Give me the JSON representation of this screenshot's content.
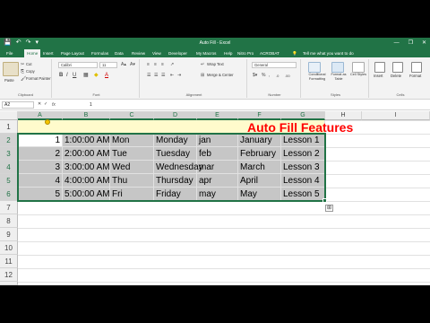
{
  "window": {
    "title": "Auto Fill - Excel",
    "qat": [
      "💾",
      "↶",
      "↷",
      "▾"
    ],
    "controls": [
      "—",
      "❐",
      "✕"
    ]
  },
  "tabs": [
    "File",
    "Home",
    "Insert",
    "Page Layout",
    "Formulas",
    "Data",
    "Review",
    "View",
    "Developer",
    "My Macros",
    "Help",
    "Nitro Pro",
    "ACROBAT"
  ],
  "active_tab": "Home",
  "tell_me": "Tell me what you want to do",
  "ribbon": {
    "clipboard": {
      "paste": "Paste",
      "cut": "Cut",
      "copy": "Copy",
      "format_painter": "Format Painter",
      "label": "Clipboard"
    },
    "font": {
      "name": "Calibri",
      "size": "11",
      "label": "Font"
    },
    "alignment": {
      "wrap": "Wrap Text",
      "merge": "Merge & Center",
      "label": "Alignment"
    },
    "number": {
      "format": "General",
      "label": "Number"
    },
    "styles": {
      "conditional": "Conditional Formatting",
      "format_table": "Format as Table",
      "cell_styles": "Cell Styles",
      "label": "Styles"
    },
    "cells": {
      "insert": "Insert",
      "delete": "Delete",
      "format": "Format",
      "label": "Cells"
    }
  },
  "formula_bar": {
    "name_box": "A2",
    "fx": "fx",
    "value": "1"
  },
  "columns": [
    "A",
    "B",
    "C",
    "D",
    "E",
    "F",
    "G",
    "H",
    "I"
  ],
  "rows": [
    "1",
    "2",
    "3",
    "4",
    "5",
    "6",
    "7",
    "8",
    "9",
    "10",
    "11",
    "12",
    "13"
  ],
  "sheet": {
    "title": "Auto Fill Features",
    "data": [
      [
        "1",
        "1:00:00 AM",
        "Mon",
        "Monday",
        "jan",
        "January",
        "Lesson 1"
      ],
      [
        "2",
        "2:00:00 AM",
        "Tue",
        "Tuesday",
        "feb",
        "February",
        "Lesson 2"
      ],
      [
        "3",
        "3:00:00 AM",
        "Wed",
        "Wednesday",
        "mar",
        "March",
        "Lesson 3"
      ],
      [
        "4",
        "4:00:00 AM",
        "Thu",
        "Thursday",
        "apr",
        "April",
        "Lesson 4"
      ],
      [
        "5",
        "5:00:00 AM",
        "Fri",
        "Friday",
        "may",
        "May",
        "Lesson 5"
      ]
    ]
  },
  "colors": {
    "excel_green": "#217346",
    "title_red": "#ff0000",
    "title_fill": "#fffbcc",
    "selection_fill": "#c6c6c6"
  }
}
